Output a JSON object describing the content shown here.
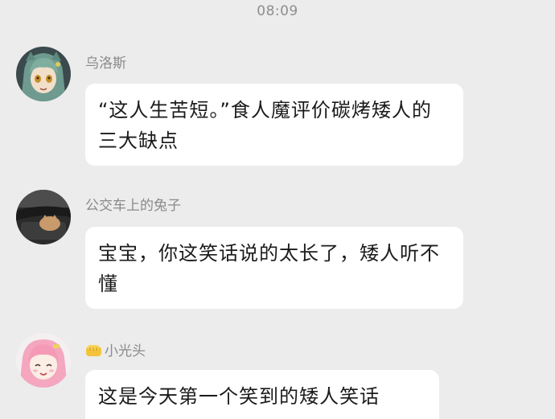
{
  "status_bar": {
    "time": "08:09"
  },
  "messages": [
    {
      "sender": "乌洛斯",
      "avatar_icon": "anime-girl-green-hair-avatar",
      "text": "“这人生苦短。”食人魔评价碳烤矮人的三大缺点"
    },
    {
      "sender": "公交车上的兔子",
      "avatar_icon": "photo-avatar",
      "text": "宝宝，你这笑话说的太长了，矮人听不懂"
    },
    {
      "sender": "小光头",
      "sender_badge_icon": "yellow-fist-emoji-icon",
      "avatar_icon": "anime-girl-pink-hair-avatar",
      "text": "这是今天第一个笑到的矮人笑话"
    }
  ],
  "colors": {
    "background": "#ececec",
    "bubble": "#ffffff",
    "sender_name": "#8a8a8a",
    "message_text": "#1b1b1b"
  }
}
